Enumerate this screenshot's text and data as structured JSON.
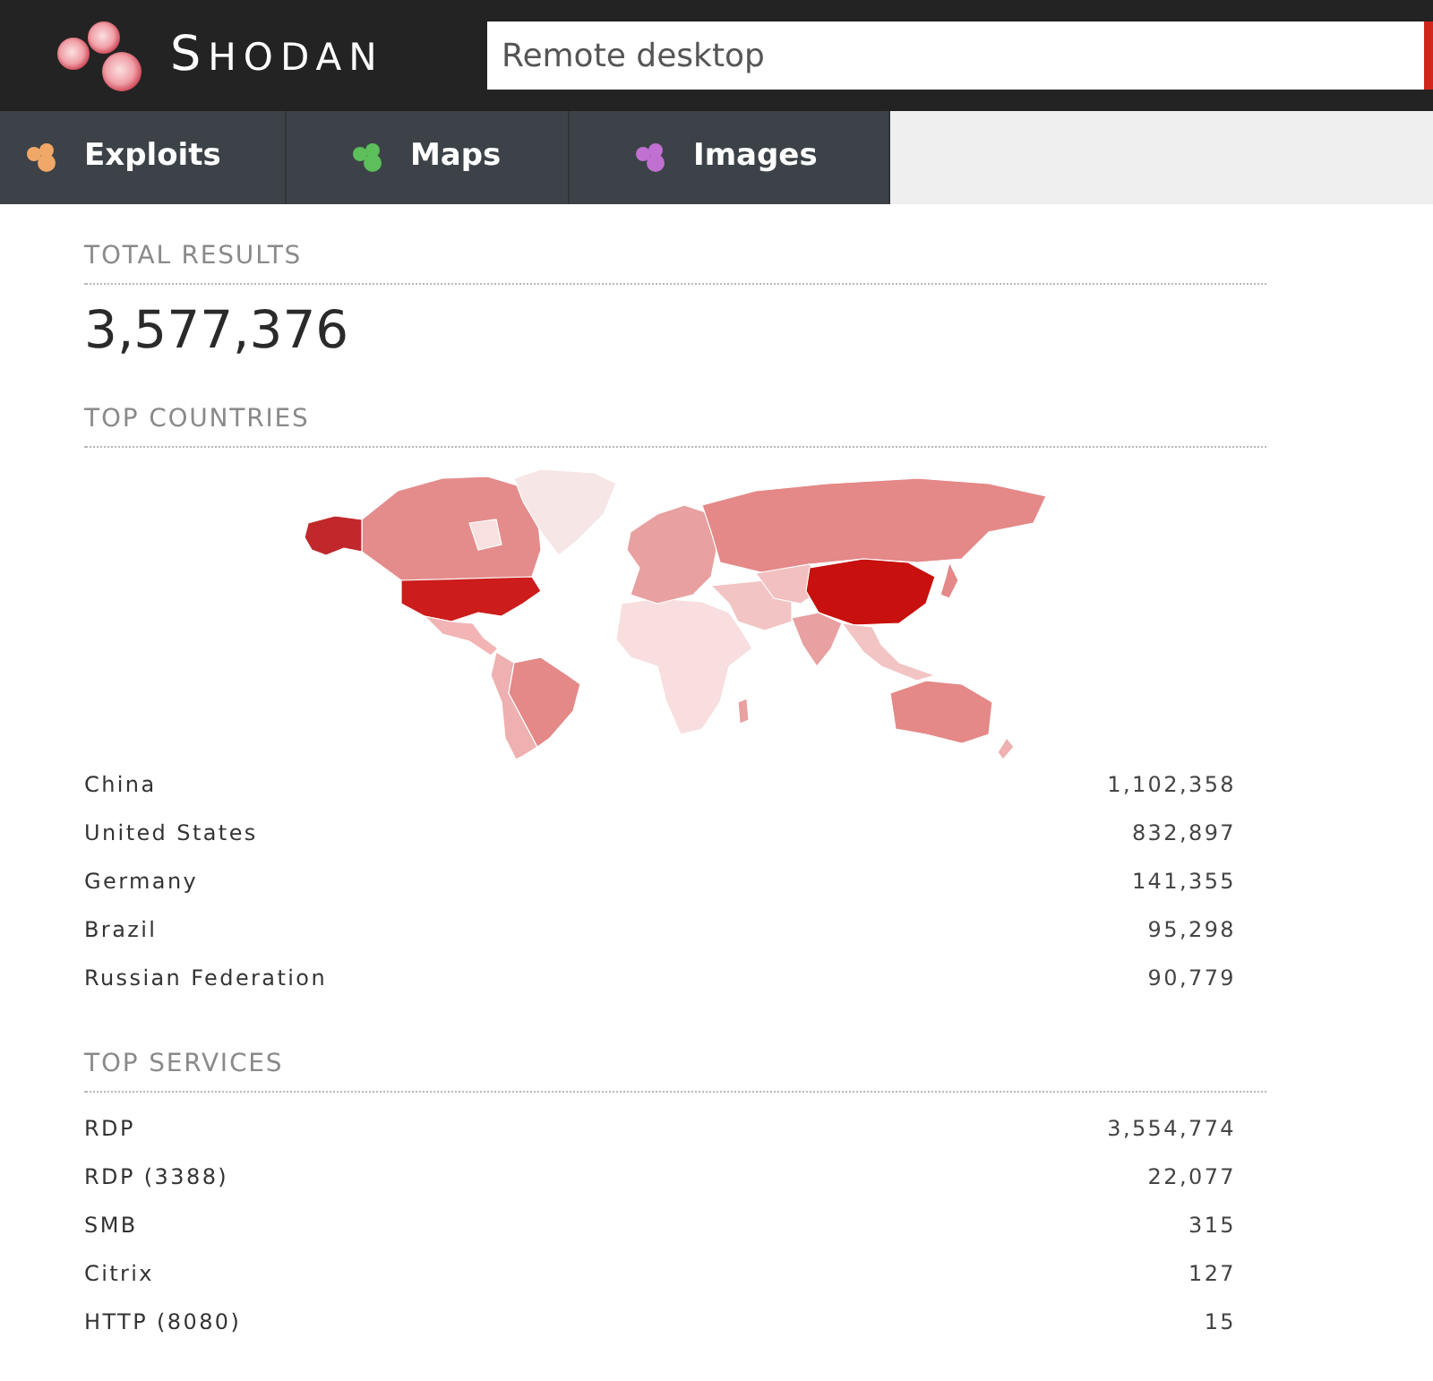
{
  "header": {
    "logo_text": "SHODAN",
    "search": {
      "value": "Remote desktop"
    }
  },
  "tabs": [
    {
      "label": "Exploits",
      "color": "#f0a868"
    },
    {
      "label": "Maps",
      "color": "#5cbf5c"
    },
    {
      "label": "Images",
      "color": "#c070d0"
    }
  ],
  "total_results": {
    "heading": "TOTAL RESULTS",
    "value": "3,577,376"
  },
  "top_countries": {
    "heading": "TOP COUNTRIES",
    "rows": [
      {
        "name": "China",
        "count": "1,102,358"
      },
      {
        "name": "United States",
        "count": "832,897"
      },
      {
        "name": "Germany",
        "count": "141,355"
      },
      {
        "name": "Brazil",
        "count": "95,298"
      },
      {
        "name": "Russian Federation",
        "count": "90,779"
      }
    ]
  },
  "top_services": {
    "heading": "TOP SERVICES",
    "rows": [
      {
        "name": "RDP",
        "count": "3,554,774"
      },
      {
        "name": "RDP (3388)",
        "count": "22,077"
      },
      {
        "name": "SMB",
        "count": "315"
      },
      {
        "name": "Citrix",
        "count": "127"
      },
      {
        "name": "HTTP (8080)",
        "count": "15"
      }
    ]
  }
}
